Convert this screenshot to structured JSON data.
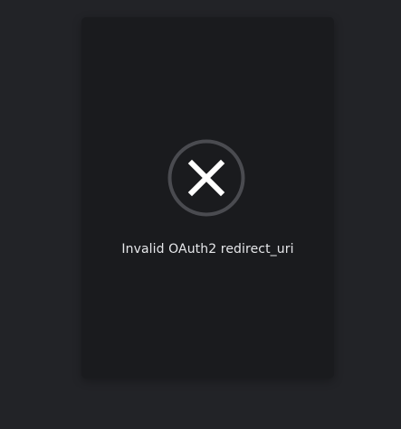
{
  "error_card": {
    "icon": "close-circle-icon",
    "message": "Invalid OAuth2 redirect_uri"
  },
  "colors": {
    "page_background": "#222327",
    "card_background": "#1a1b1e",
    "icon_ring": "#4a4b50",
    "icon_cross": "#ffffff",
    "message_text": "#e6e7ea"
  }
}
